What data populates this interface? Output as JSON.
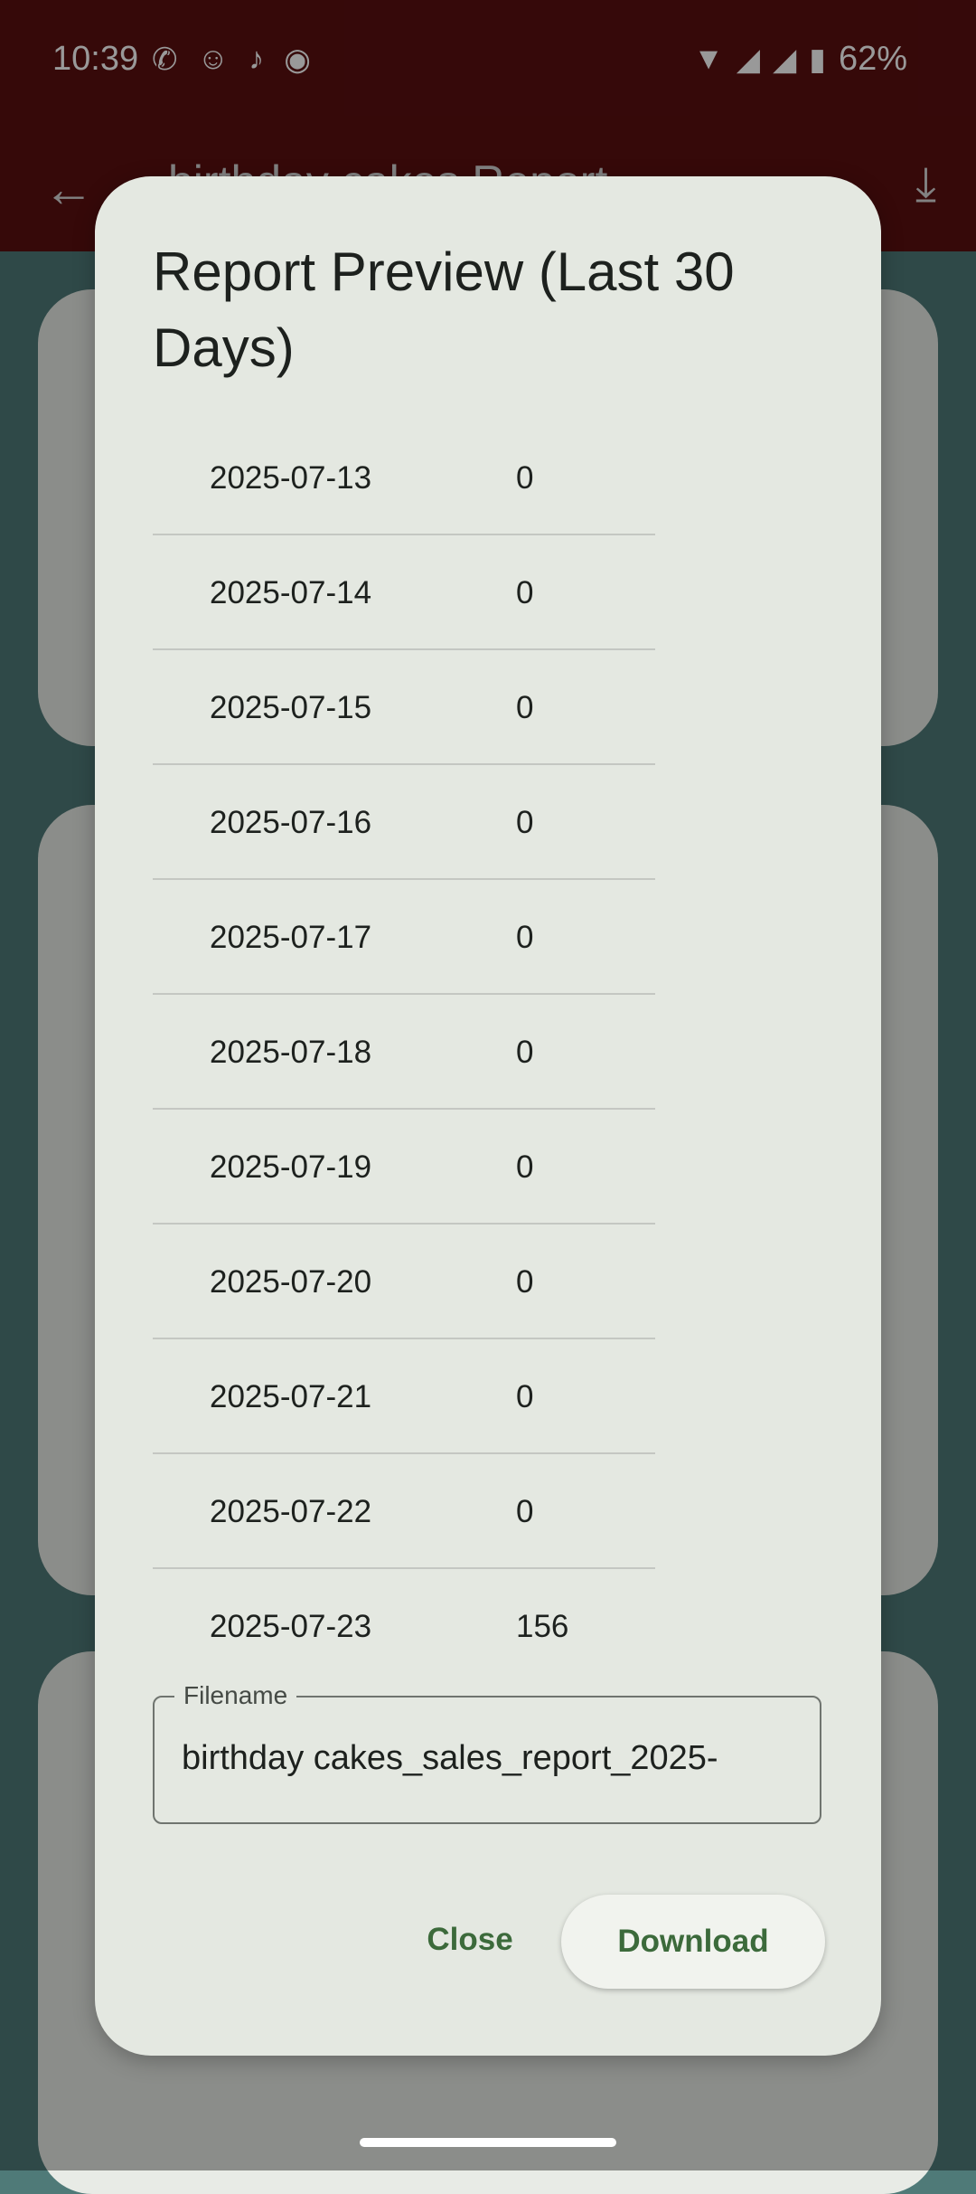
{
  "status_bar": {
    "time": "10:39",
    "battery": "62%",
    "left_icons": [
      "whatsapp-icon",
      "snapchat-icon",
      "tiktok-icon",
      "screen-record-icon"
    ],
    "right_icons": [
      "wifi-icon",
      "signal-icon",
      "signal-icon",
      "battery-icon"
    ]
  },
  "app_bar": {
    "title": "birthday cakes Report"
  },
  "dialog": {
    "title": "Report Preview (Last 30 Days)",
    "rows": [
      {
        "date": "2025-07-13",
        "value": "0"
      },
      {
        "date": "2025-07-14",
        "value": "0"
      },
      {
        "date": "2025-07-15",
        "value": "0"
      },
      {
        "date": "2025-07-16",
        "value": "0"
      },
      {
        "date": "2025-07-17",
        "value": "0"
      },
      {
        "date": "2025-07-18",
        "value": "0"
      },
      {
        "date": "2025-07-19",
        "value": "0"
      },
      {
        "date": "2025-07-20",
        "value": "0"
      },
      {
        "date": "2025-07-21",
        "value": "0"
      },
      {
        "date": "2025-07-22",
        "value": "0"
      },
      {
        "date": "2025-07-23",
        "value": "156"
      }
    ],
    "filename_label": "Filename",
    "filename_value": "birthday cakes_sales_report_2025-",
    "close_label": "Close",
    "download_label": "Download"
  },
  "colors": {
    "appbar": "#5a0f10",
    "background": "#4f7a78",
    "dialog": "#e4e8e1",
    "accent": "#3c6a3b"
  }
}
